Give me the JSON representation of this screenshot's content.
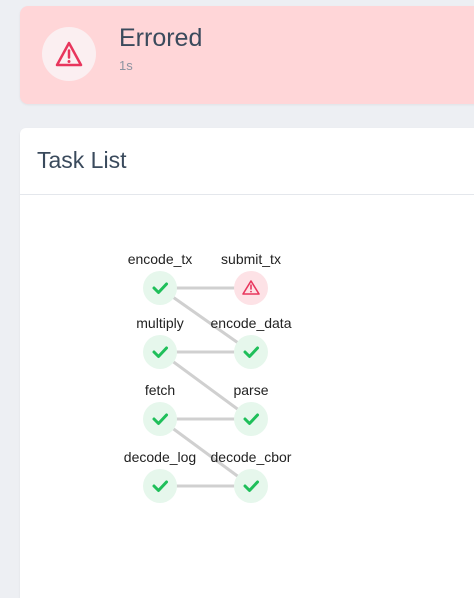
{
  "status": {
    "title": "Errored",
    "duration": "1s",
    "icon": "warning-triangle-icon",
    "color": "#e8365d"
  },
  "task_list": {
    "title": "Task List",
    "tasks": [
      {
        "id": "encode_tx",
        "label": "encode_tx",
        "state": "success"
      },
      {
        "id": "submit_tx",
        "label": "submit_tx",
        "state": "errored"
      },
      {
        "id": "multiply",
        "label": "multiply",
        "state": "success"
      },
      {
        "id": "encode_data",
        "label": "encode_data",
        "state": "success"
      },
      {
        "id": "fetch",
        "label": "fetch",
        "state": "success"
      },
      {
        "id": "parse",
        "label": "parse",
        "state": "success"
      },
      {
        "id": "decode_log",
        "label": "decode_log",
        "state": "success"
      },
      {
        "id": "decode_cbor",
        "label": "decode_cbor",
        "state": "success"
      }
    ],
    "edges": [
      [
        "encode_tx",
        "submit_tx"
      ],
      [
        "encode_tx",
        "encode_data"
      ],
      [
        "multiply",
        "encode_data"
      ],
      [
        "multiply",
        "parse"
      ],
      [
        "fetch",
        "parse"
      ],
      [
        "fetch",
        "decode_cbor"
      ],
      [
        "decode_log",
        "decode_cbor"
      ]
    ],
    "colors": {
      "success_fill": "#e6f7ec",
      "success_check": "#1fbf5a",
      "error_fill": "#fde2e6",
      "error_icon": "#e8365d",
      "edge": "#d0d0d0"
    }
  }
}
